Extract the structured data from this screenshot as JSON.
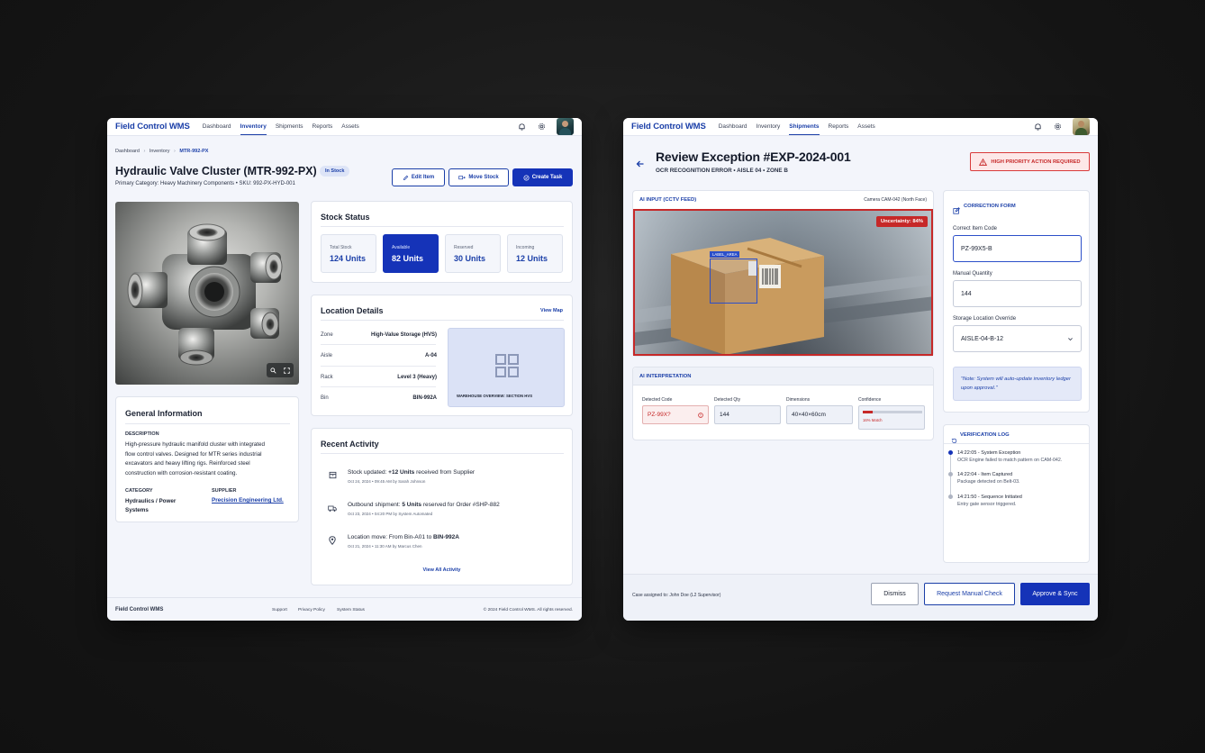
{
  "left": {
    "brand": "Field Control WMS",
    "nav": [
      "Dashboard",
      "Inventory",
      "Shipments",
      "Reports",
      "Assets"
    ],
    "active_nav": "Inventory",
    "breadcrumb": [
      "Dashboard",
      "Inventory",
      "MTR-992-PX"
    ],
    "title": "Hydraulic Valve Cluster (MTR-992-PX)",
    "status_badge": "In Stock",
    "subtitle": "Primary Category: Heavy Machinery Components • SKU: 992-PX-HYD-001",
    "actions": {
      "edit": "Edit Item",
      "move": "Move Stock",
      "create": "Create Task"
    },
    "stock": {
      "title": "Stock Status",
      "items": [
        {
          "label": "Total Stock",
          "value": "124 Units"
        },
        {
          "label": "Available",
          "value": "82 Units"
        },
        {
          "label": "Reserved",
          "value": "30 Units"
        },
        {
          "label": "Incoming",
          "value": "12 Units"
        }
      ]
    },
    "location": {
      "title": "Location Details",
      "view_map": "View Map",
      "rows": [
        {
          "k": "Zone",
          "v": "High-Value Storage (HVS)"
        },
        {
          "k": "Aisle",
          "v": "A-04"
        },
        {
          "k": "Rack",
          "v": "Level 3 (Heavy)"
        },
        {
          "k": "Bin",
          "v": "BIN-992A"
        }
      ],
      "map_caption": "WAREHOUSE OVERVIEW: SECTION HVS"
    },
    "general": {
      "title": "General Information",
      "desc_label": "DESCRIPTION",
      "desc_lines": [
        "High-pressure hydraulic manifold cluster with integrated",
        "flow control valves. Designed for MTR series industrial",
        "excavators and heavy lifting rigs. Reinforced steel",
        "construction with corrosion-resistant coating."
      ],
      "category_label": "CATEGORY",
      "category_lines": [
        "Hydraulics / Power",
        "Systems"
      ],
      "supplier_label": "SUPPLIER",
      "supplier": "Precision Engineering Ltd."
    },
    "activity": {
      "title": "Recent Activity",
      "items": [
        {
          "icon": "box-icon",
          "pre": "Stock updated: ",
          "bold": "+12 Units",
          "post": " received from Supplier",
          "sub": "Oct 24, 2024 • 09:45 AM by Sarah Johnson"
        },
        {
          "icon": "truck-icon",
          "pre": "Outbound shipment: ",
          "bold": "5 Units",
          "post": " reserved for Order #SHP-882",
          "sub": "Oct 23, 2024 • 04:20 PM by System Automated"
        },
        {
          "icon": "pin-icon",
          "pre": "Location move: From Bin-A01 to ",
          "bold": "BIN-992A",
          "post": "",
          "sub": "Oct 21, 2024 • 11:30 AM by Marcus Chen"
        }
      ],
      "view_all": "View All Activity"
    },
    "footer": {
      "brand": "Field Control WMS",
      "links": [
        "Support",
        "Privacy Policy",
        "System Status"
      ],
      "copyright": "© 2024 Field Control WMS. All rights reserved."
    }
  },
  "right": {
    "brand": "Field Control WMS",
    "nav": [
      "Dashboard",
      "Inventory",
      "Shipments",
      "Reports",
      "Assets"
    ],
    "active_nav": "Shipments",
    "title": "Review Exception #EXP-2024-001",
    "subtitle": "OCR RECOGNITION ERROR • AISLE 04 • ZONE B",
    "priority_badge": "HIGH PRIORITY ACTION REQUIRED",
    "feed": {
      "label": "AI INPUT (CCTV FEED)",
      "camera": "Camera CAM-042 (North Face)",
      "uncertainty": "Uncertainty: 84%",
      "box_label": "LABEL_AREA"
    },
    "interpretation": {
      "title": "AI INTERPRETATION",
      "fields": [
        {
          "label": "Detected Code",
          "value": "PZ-99X?"
        },
        {
          "label": "Detected Qty",
          "value": "144"
        },
        {
          "label": "Dimensions",
          "value": "40×40×60cm"
        },
        {
          "label": "Confidence",
          "value": "16% Match"
        }
      ],
      "confidence": 0.16
    },
    "form": {
      "title": "CORRECTION FORM",
      "code_label": "Correct Item Code",
      "code_value": "PZ-99X5-B",
      "qty_label": "Manual Quantity",
      "qty_value": "144",
      "loc_label": "Storage Location Override",
      "loc_value": "AISLE-04-B-12",
      "note": "\"Note: System will auto-update inventory ledger upon approval.\""
    },
    "log": {
      "title": "VERIFICATION LOG",
      "items": [
        {
          "time": "14:22:05 - System Exception",
          "desc": "OCR Engine failed to match pattern on CAM-042."
        },
        {
          "time": "14:22:04 - Item Captured",
          "desc": "Package detected on Belt-03."
        },
        {
          "time": "14:21:50 - Sequence Initiated",
          "desc": "Entry gate sensor triggered."
        }
      ]
    },
    "footer": {
      "assigned": "Case assigned to: John Doe (L2 Supervisor)",
      "dismiss": "Dismiss",
      "manual": "Request Manual Check",
      "approve": "Approve & Sync"
    },
    "colors": {
      "accent": "#1533b8",
      "danger": "#c62828",
      "warning_bg": "#fde8e8"
    }
  }
}
